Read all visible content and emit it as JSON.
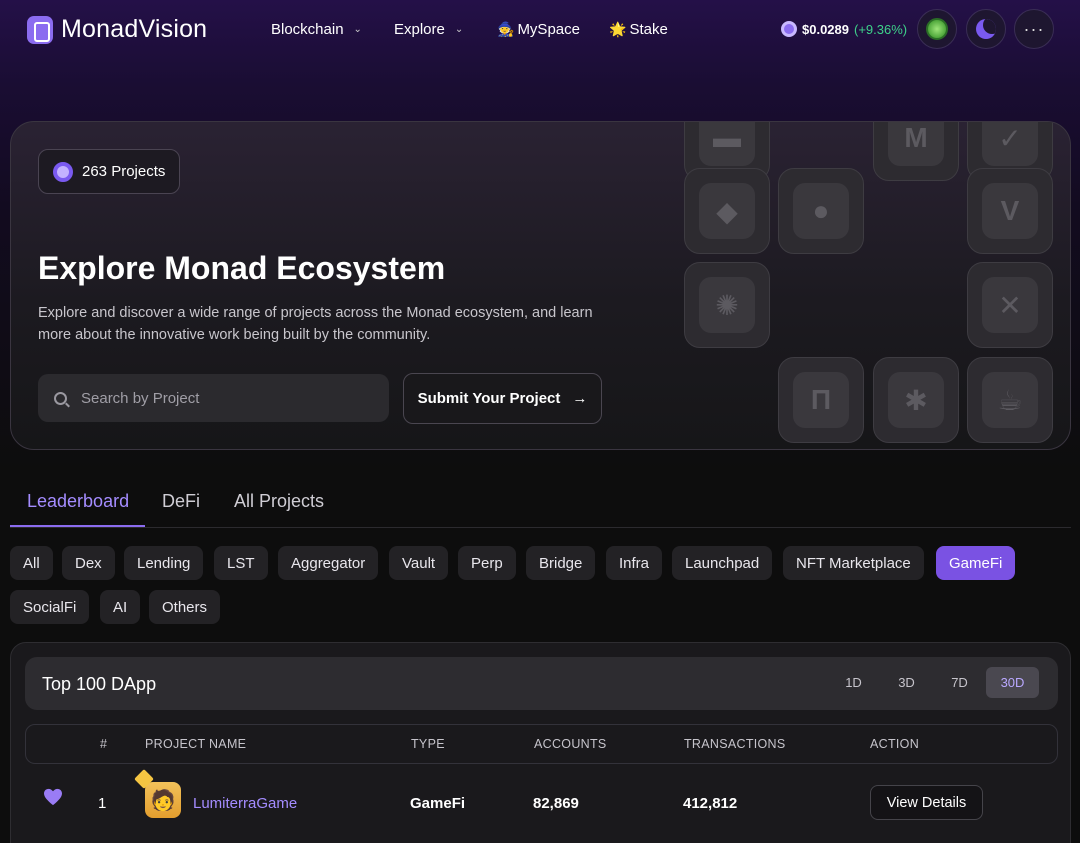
{
  "nav": {
    "logo_text": "MonadVision",
    "items": [
      {
        "label": "Blockchain",
        "chevron": true
      },
      {
        "label": "Explore",
        "chevron": true
      },
      {
        "label": "MySpace",
        "emoji": "🧙"
      },
      {
        "label": "Stake",
        "emoji": "🌟"
      }
    ],
    "price": "$0.0289",
    "price_change": "(+9.36%)",
    "more_label": "···"
  },
  "hero": {
    "badge": "263 Projects",
    "title": "Explore Monad Ecosystem",
    "description": "Explore and discover a wide range of projects across the Monad ecosystem, and learn more about the innovative work being built by the community.",
    "search_placeholder": "Search by Project",
    "submit_label": "Submit Your Project",
    "submit_arrow": "→"
  },
  "tabs": [
    "Leaderboard",
    "DeFi",
    "All Projects"
  ],
  "active_tab": "Leaderboard",
  "categories": [
    "All",
    "Dex",
    "Lending",
    "LST",
    "Aggregator",
    "Vault",
    "Perp",
    "Bridge",
    "Infra",
    "Launchpad",
    "NFT Marketplace",
    "GameFi",
    "SocialFi",
    "AI",
    "Others"
  ],
  "active_category": "GameFi",
  "table": {
    "title": "Top 100 DApp",
    "ranges": [
      "1D",
      "3D",
      "7D",
      "30D"
    ],
    "active_range": "30D",
    "headers": [
      "#",
      "PROJECT NAME",
      "TYPE",
      "ACCOUNTS",
      "TRANSACTIONS",
      "ACTION"
    ],
    "rows": [
      {
        "rank": "1",
        "name": "LumiterraGame",
        "type": "GameFi",
        "accounts": "82,869",
        "transactions": "412,812",
        "action": "View Details"
      }
    ]
  },
  "colors": {
    "accent": "#8b6cf0",
    "positive": "#3ed18a",
    "active_chip": "#7a52e3"
  }
}
